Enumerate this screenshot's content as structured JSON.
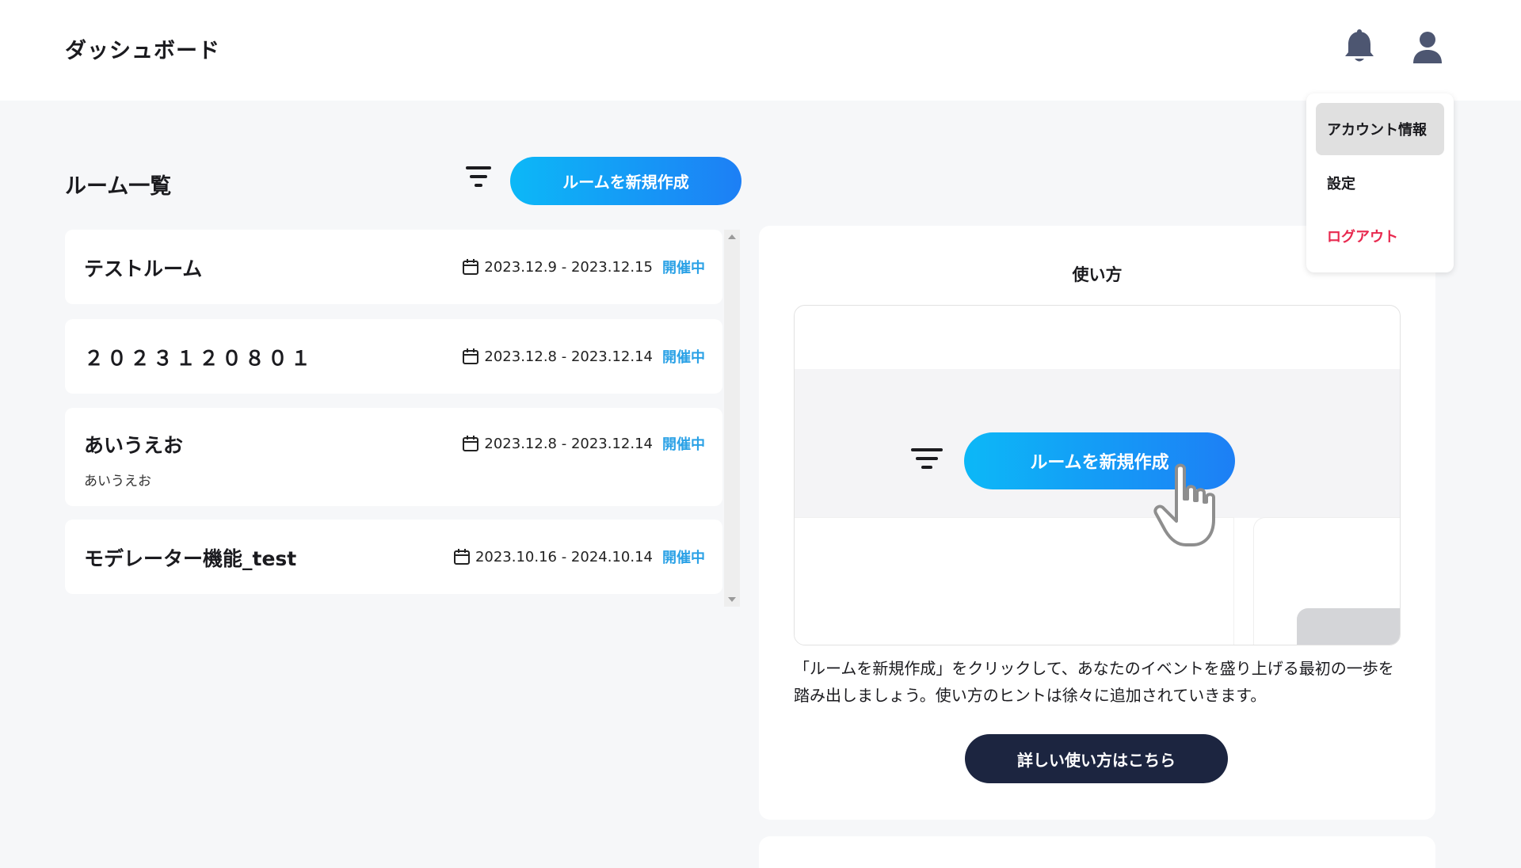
{
  "header": {
    "title": "ダッシュボード",
    "bell_icon": "bell-icon",
    "user_icon": "user-icon"
  },
  "rooms": {
    "title": "ルーム一覧",
    "filter_icon": "filter-icon",
    "create_label": "ルームを新規作成",
    "items": [
      {
        "name": "テストルーム",
        "description": "",
        "period": "2023.12.9 - 2023.12.15",
        "status": "開催中"
      },
      {
        "name": "２０２３１２０８０１",
        "description": "",
        "period": "2023.12.8 - 2023.12.14",
        "status": "開催中"
      },
      {
        "name": "あいうえお",
        "description": "あいうえお",
        "period": "2023.12.8 - 2023.12.14",
        "status": "開催中"
      },
      {
        "name": "モデレーター機能_test",
        "description": "",
        "period": "2023.10.16 - 2024.10.14",
        "status": "開催中"
      }
    ]
  },
  "howto": {
    "title": "使い方",
    "preview_button": "ルームを新規作成",
    "text": "「ルームを新規作成」をクリックして、あなたのイベントを盛り上げる最初の一歩を踏み出しましょう。使い方のヒントは徐々に追加されていきます。",
    "guide_label": "詳しい使い方はこちら"
  },
  "account_menu": {
    "items": [
      {
        "label": "アカウント情報",
        "active": true
      },
      {
        "label": "設定"
      },
      {
        "label": "ログアウト",
        "danger": true
      }
    ]
  },
  "colors": {
    "accent_start": "#0cb8f7",
    "accent_end": "#1d7ff5",
    "status": "#2aa1e6",
    "logout": "#e8294f",
    "guide_button": "#1c2540"
  }
}
